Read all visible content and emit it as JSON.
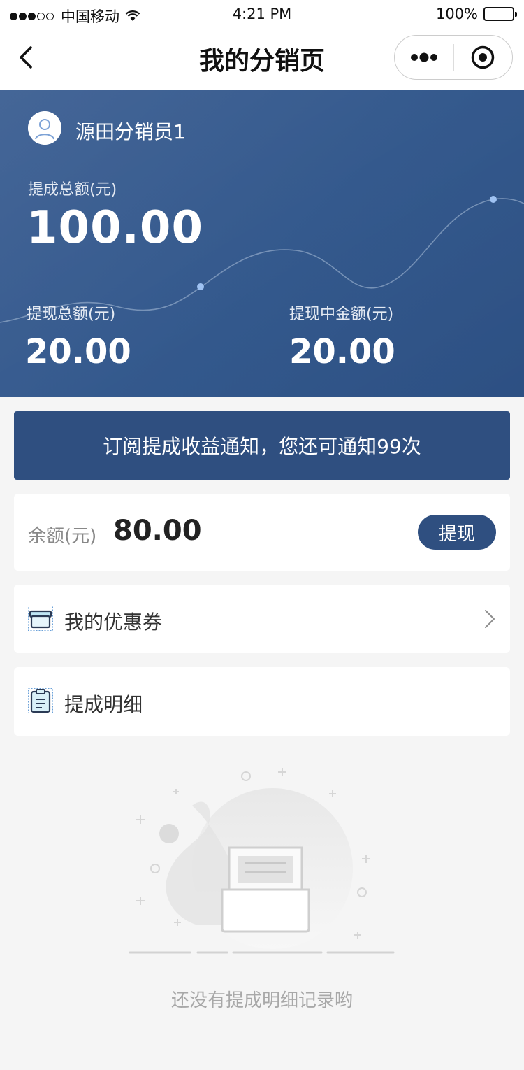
{
  "status_bar": {
    "carrier": "中国移动",
    "time": "4:21 PM",
    "battery": "100%"
  },
  "nav": {
    "title": "我的分销页"
  },
  "header": {
    "user_name": "源田分销员1",
    "total_label": "提成总额(元)",
    "total_value": "100.00",
    "withdraw_total_label": "提现总额(元)",
    "withdraw_total_value": "20.00",
    "withdrawing_label": "提现中金额(元)",
    "withdrawing_value": "20.00"
  },
  "subscribe": {
    "label": "订阅提成收益通知，您还可通知99次"
  },
  "balance": {
    "label": "余额(元)",
    "value": "80.00",
    "withdraw_label": "提现"
  },
  "menu": {
    "coupon_label": "我的优惠券",
    "detail_label": "提成明细"
  },
  "empty": {
    "text": "还没有提成明细记录哟"
  },
  "colors": {
    "primary": "#2f4f80",
    "header_bg": "#335585",
    "background": "#f5f5f5"
  }
}
